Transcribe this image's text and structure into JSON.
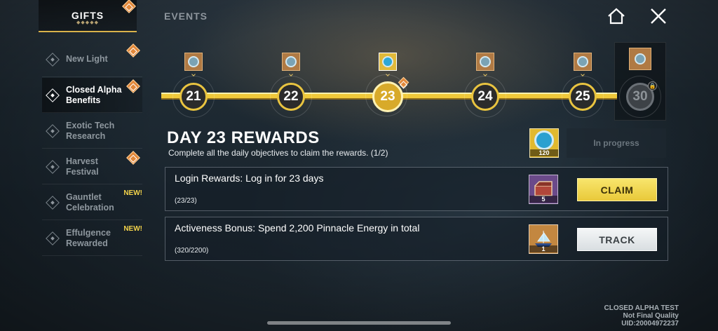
{
  "top_tabs": [
    {
      "label": "GIFTS",
      "active": true
    },
    {
      "label": "EVENTS",
      "active": false
    }
  ],
  "top_icons": {
    "home": "home-icon",
    "close": "close-icon"
  },
  "sidebar": {
    "items": [
      {
        "label": "New Light",
        "active": false,
        "badge": true,
        "new": ""
      },
      {
        "label": "Closed Alpha Benefits",
        "active": true,
        "badge": true,
        "new": ""
      },
      {
        "label": "Exotic Tech Research",
        "active": false,
        "badge": false,
        "new": ""
      },
      {
        "label": "Harvest Festival",
        "active": false,
        "badge": true,
        "new": ""
      },
      {
        "label": "Gauntlet Celebration",
        "active": false,
        "badge": false,
        "new": "NEW!"
      },
      {
        "label": "Effulgence Rewarded",
        "active": false,
        "badge": false,
        "new": "NEW!"
      }
    ]
  },
  "timeline": {
    "days": [
      "21",
      "22",
      "23",
      "24",
      "25",
      "30"
    ],
    "current": "23",
    "locked": "30"
  },
  "rewards": {
    "title": "DAY 23 REWARDS",
    "subtitle": "Complete all the daily objectives to claim the rewards.  (1/2)",
    "main_reward_count": "120",
    "status": "In progress"
  },
  "tasks": [
    {
      "title": "Login Rewards: Log in for 23 days",
      "progress": "(23/23)",
      "reward_count": "5",
      "button": "CLAIM"
    },
    {
      "title": "Activeness Bonus: Spend 2,200 Pinnacle Energy in total",
      "progress": "(320/2200)",
      "reward_count": "1",
      "button": "TRACK"
    }
  ],
  "footer": {
    "line1": "CLOSED ALPHA TEST",
    "line2": "Not Final Quality",
    "uid": "UID:20004972237"
  },
  "colors": {
    "accent": "#e9c440",
    "claim": "#f2d84a",
    "badge": "#e2883a",
    "new": "#f2d24a"
  }
}
